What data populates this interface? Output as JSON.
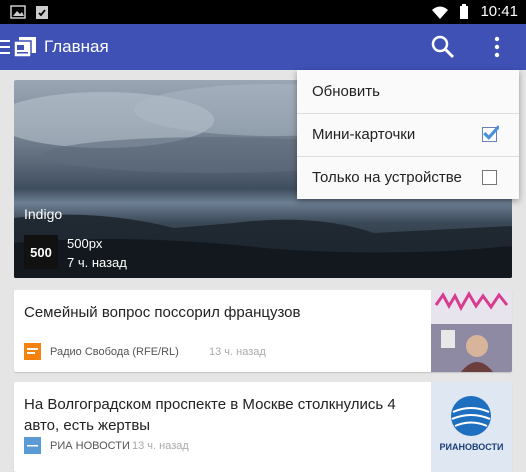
{
  "statusbar": {
    "time": "10:41"
  },
  "appbar": {
    "title": "Главная"
  },
  "hero": {
    "label": "Indigo",
    "logo_text": "500",
    "source": "500px",
    "time": "7 ч. назад"
  },
  "cards": [
    {
      "headline": "Семейный вопрос поссорил французов",
      "source": "Радио Свобода (RFE/RL)",
      "time": "13 ч. назад"
    },
    {
      "headline": "На Волгоградском проспекте в Москве столкнулись 4 авто, есть жертвы",
      "source": "РИА НОВОСТИ",
      "time": "13 ч. назад",
      "thumb_text": "РИАНОВОСТИ"
    }
  ],
  "menu": {
    "items": [
      {
        "label": "Обновить"
      },
      {
        "label": "Мини-карточки",
        "checked": true
      },
      {
        "label": "Только на устройстве",
        "checked": false
      }
    ]
  },
  "colors": {
    "appbar": "#3f51b5",
    "accent": "#4a90d9"
  }
}
